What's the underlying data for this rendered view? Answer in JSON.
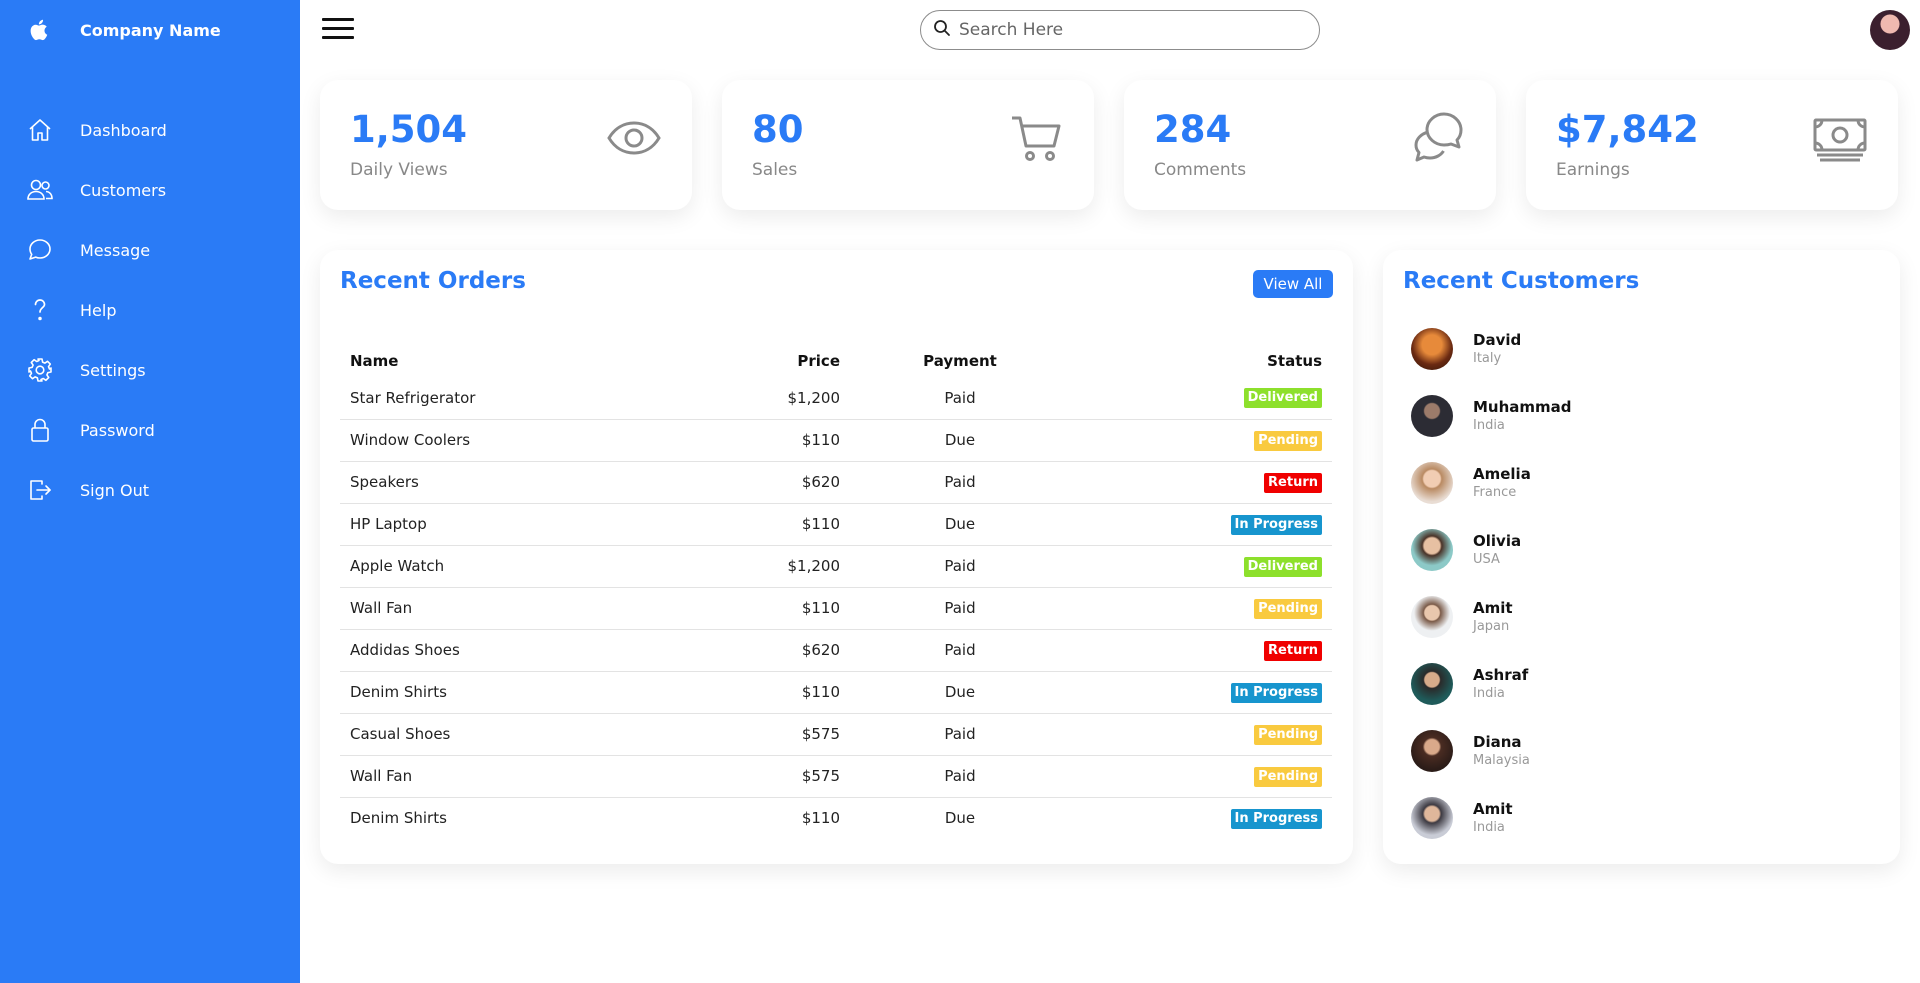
{
  "brand": {
    "name": "Company Name",
    "icon": "apple-icon"
  },
  "sidebar": {
    "items": [
      {
        "label": "Dashboard",
        "icon": "home-icon"
      },
      {
        "label": "Customers",
        "icon": "people-icon"
      },
      {
        "label": "Message",
        "icon": "chat-icon"
      },
      {
        "label": "Help",
        "icon": "question-icon"
      },
      {
        "label": "Settings",
        "icon": "gear-icon"
      },
      {
        "label": "Password",
        "icon": "lock-icon"
      },
      {
        "label": "Sign Out",
        "icon": "sign-out-icon"
      }
    ]
  },
  "topbar": {
    "search_placeholder": "Search Here"
  },
  "cards": [
    {
      "number": "1,504",
      "label": "Daily Views",
      "icon": "eye-icon"
    },
    {
      "number": "80",
      "label": "Sales",
      "icon": "cart-icon"
    },
    {
      "number": "284",
      "label": "Comments",
      "icon": "comments-icon"
    },
    {
      "number": "$7,842",
      "label": "Earnings",
      "icon": "cash-icon"
    }
  ],
  "orders": {
    "title": "Recent Orders",
    "view_all": "View All",
    "headers": {
      "name": "Name",
      "price": "Price",
      "payment": "Payment",
      "status": "Status"
    },
    "rows": [
      {
        "name": "Star Refrigerator",
        "price": "$1,200",
        "payment": "Paid",
        "status": "Delivered"
      },
      {
        "name": "Window Coolers",
        "price": "$110",
        "payment": "Due",
        "status": "Pending"
      },
      {
        "name": "Speakers",
        "price": "$620",
        "payment": "Paid",
        "status": "Return"
      },
      {
        "name": "HP Laptop",
        "price": "$110",
        "payment": "Due",
        "status": "In Progress"
      },
      {
        "name": "Apple Watch",
        "price": "$1,200",
        "payment": "Paid",
        "status": "Delivered"
      },
      {
        "name": "Wall Fan",
        "price": "$110",
        "payment": "Paid",
        "status": "Pending"
      },
      {
        "name": "Addidas Shoes",
        "price": "$620",
        "payment": "Paid",
        "status": "Return"
      },
      {
        "name": "Denim Shirts",
        "price": "$110",
        "payment": "Due",
        "status": "In Progress"
      },
      {
        "name": "Casual Shoes",
        "price": "$575",
        "payment": "Paid",
        "status": "Pending"
      },
      {
        "name": "Wall Fan",
        "price": "$575",
        "payment": "Paid",
        "status": "Pending"
      },
      {
        "name": "Denim Shirts",
        "price": "$110",
        "payment": "Due",
        "status": "In Progress"
      }
    ]
  },
  "status_colors": {
    "Delivered": "#8de02c",
    "Pending": "#f9ca3f",
    "Return": "#f00000",
    "In Progress": "#1795ce"
  },
  "customers": {
    "title": "Recent Customers",
    "list": [
      {
        "name": "David",
        "country": "Italy"
      },
      {
        "name": "Muhammad",
        "country": "India"
      },
      {
        "name": "Amelia",
        "country": "France"
      },
      {
        "name": "Olivia",
        "country": "USA"
      },
      {
        "name": "Amit",
        "country": "Japan"
      },
      {
        "name": "Ashraf",
        "country": "India"
      },
      {
        "name": "Diana",
        "country": "Malaysia"
      },
      {
        "name": "Amit",
        "country": "India"
      }
    ]
  },
  "colors": {
    "accent": "#2a7bf6",
    "muted_text": "#888888",
    "icon_gray": "#8a8a8a"
  }
}
